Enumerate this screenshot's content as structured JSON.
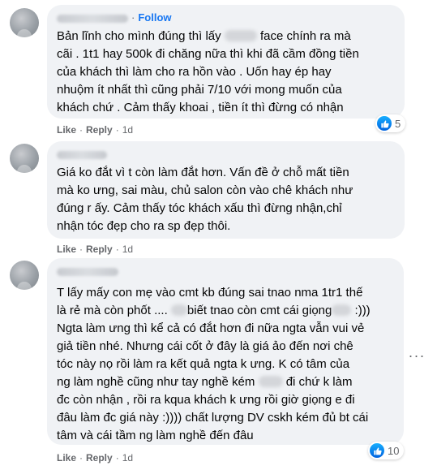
{
  "comments": [
    {
      "follow_label": "Follow",
      "separator": "·",
      "lines": [
        [
          "Bản lĩnh cho mình đúng thì lấy ",
          " face chính ra mà"
        ],
        [
          "cãi . 1t1 hay 500k đi chăng nữa thì khi đã cầm đồng tiền"
        ],
        [
          "của khách thì làm cho ra hồn vào . Uốn hay ép hay"
        ],
        [
          "nhuộm ít nhất thì cũng phải 7/10 với mong muốn của"
        ],
        [
          "khách chứ . Cảm thấy khoai , tiền ít thì đừng có nhận"
        ]
      ],
      "like_label": "Like",
      "reply_label": "Reply",
      "time": "1d",
      "reaction_count": "5"
    },
    {
      "lines": [
        [
          "Giá ko đắt vì t còn làm đắt hơn. Vấn đề ở chỗ mất tiền"
        ],
        [
          "mà ko ưng, sai màu, chủ salon còn vào chê khách như"
        ],
        [
          "đúng r ấy. Cảm thấy tóc khách xấu thì đừng nhận,chỉ"
        ],
        [
          "nhận tóc đẹp cho ra sp đẹp thôi."
        ]
      ],
      "like_label": "Like",
      "reply_label": "Reply",
      "time": "1d"
    },
    {
      "lines": [
        [
          "T lấy mấy con mẹ vào cmt kb đúng sai tnao nma 1tr1 thế"
        ],
        [
          "là rẻ mà còn phốt .... ",
          "biết tnao còn cmt cái giọng",
          " :)))"
        ],
        [
          "Ngta làm ưng thì kể cả có đắt hơn đi nữa ngta vẫn vui vẻ"
        ],
        [
          "giả tiền nhé. Nhưng cái cốt ở đây là giá ảo đến nơi chê"
        ],
        [
          "tóc này nọ rồi làm ra kết quả ngta k ưng. K có tâm của"
        ],
        [
          "ng làm nghề cũng như tay nghề kém ",
          " đi chứ k làm"
        ],
        [
          "đc còn nhận , rồi ra kqua khách k ưng rồi giờ giọng e đi"
        ],
        [
          "đâu làm đc giá này :)))) chất lượng DV cskh kém đủ bt cái"
        ],
        [
          "tâm và cái tầm ng làm nghề đến đâu"
        ]
      ],
      "like_label": "Like",
      "reply_label": "Reply",
      "time": "1d",
      "reaction_count": "10",
      "more_label": "···"
    }
  ],
  "icons": {
    "reaction": "like-thumb-icon",
    "more": "more-horizontal-icon"
  },
  "colors": {
    "bubble": "#f0f2f5",
    "accent": "#1877f2",
    "meta": "#65676b"
  }
}
